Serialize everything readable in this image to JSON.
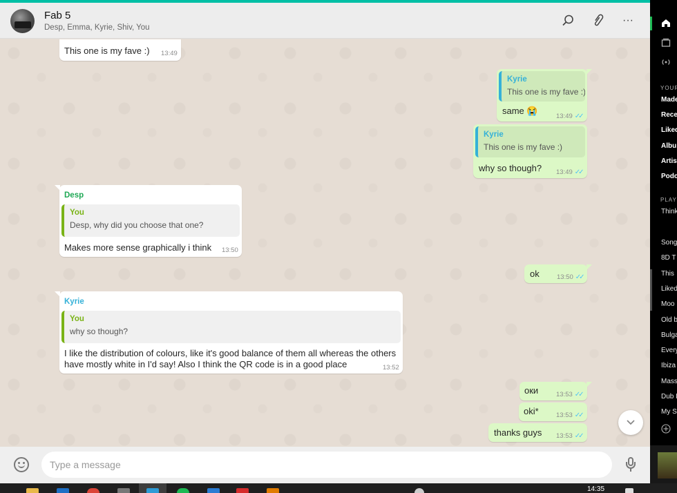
{
  "header": {
    "title": "Fab 5",
    "subtitle": "Desp, Emma, Kyrie, Shiv, You",
    "search_icon": "search-icon",
    "attach_icon": "paperclip-icon",
    "menu_icon": "more-options-icon",
    "menu_glyph": "···"
  },
  "messages": [
    {
      "id": "m1",
      "direction": "in",
      "text": "This one is my fave :)",
      "time": "13:49"
    },
    {
      "id": "m2",
      "direction": "out",
      "quote_name": "Kyrie",
      "quote_text": "This one is my fave :)",
      "text": "same 😭",
      "time": "13:49",
      "ticks": "✓✓"
    },
    {
      "id": "m3",
      "direction": "out",
      "quote_name": "Kyrie",
      "quote_text": "This one is my fave :)",
      "text": "why so though?",
      "time": "13:49",
      "ticks": "✓✓"
    },
    {
      "id": "m4",
      "direction": "in",
      "sender": "Desp",
      "quote_name": "You",
      "quote_text": "Desp, why did you choose that one?",
      "text": "Makes more sense graphically i think",
      "time": "13:50"
    },
    {
      "id": "m5",
      "direction": "out",
      "text": "ok",
      "time": "13:50",
      "ticks": "✓✓"
    },
    {
      "id": "m6",
      "direction": "in",
      "sender": "Kyrie",
      "quote_name": "You",
      "quote_text": "why so though?",
      "text_line1": "I like the distribution of colours, like it's good balance of them all whereas the others",
      "text_line2": "have mostly white in I'd say! Also I think the QR code is in a good place",
      "time": "13:52"
    },
    {
      "id": "m7",
      "direction": "out",
      "text": "оки",
      "time": "13:53",
      "ticks": "✓✓"
    },
    {
      "id": "m8",
      "direction": "out",
      "text": "oki*",
      "time": "13:53",
      "ticks": "✓✓"
    },
    {
      "id": "m9",
      "direction": "out",
      "text": "thanks guys",
      "time": "13:53",
      "ticks": "✓✓"
    }
  ],
  "colors": {
    "header_accent": "#00bfa5",
    "sender_desp": "#1fa855",
    "sender_kyrie": "#35b1d8",
    "quote_you": "#7ab317",
    "quote_kyrie": "#35b1d8"
  },
  "composer": {
    "placeholder": "Type a message",
    "emoji_icon": "emoji-icon",
    "mic_icon": "microphone-icon",
    "scroll_down_icon": "chevron-down-icon"
  },
  "spotify": {
    "section_your": "YOUR",
    "library": [
      "Made",
      "Rece",
      "Liked",
      "Albu",
      "Artis",
      "Podc"
    ],
    "section_playlists": "PLAY",
    "playlist_first": "Think",
    "playlists": [
      "Song",
      "8D T",
      "This",
      "Liked",
      "Moo",
      "Old b",
      "Bulga",
      "Every",
      "Ibiza",
      "Mass",
      "Dub I",
      "My S"
    ]
  },
  "taskbar": {
    "clock": "14:35"
  }
}
